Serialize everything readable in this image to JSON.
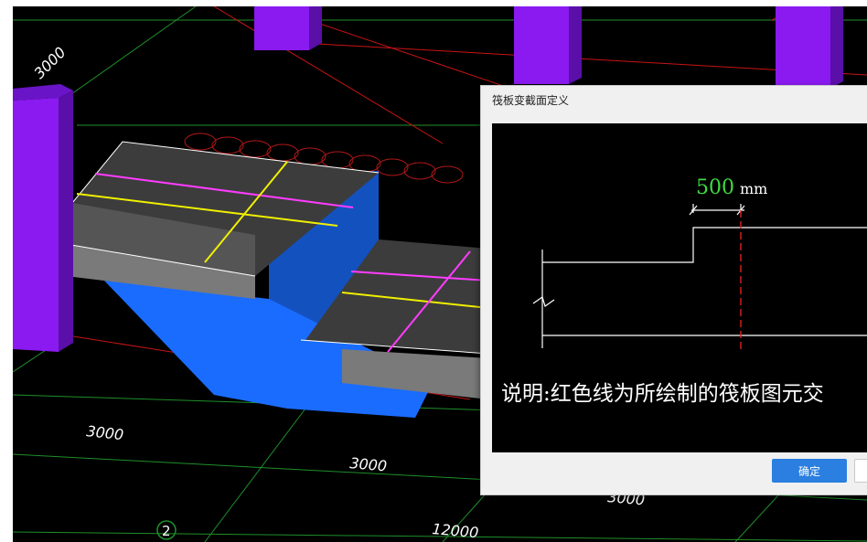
{
  "scene": {
    "dims": {
      "d1": "3000",
      "d2": "3000",
      "d3": "3000",
      "d4": "3000",
      "d5": "12000"
    },
    "axis_label": "2"
  },
  "dialog": {
    "title": "筏板变截面定义",
    "dimension_value": "500",
    "dimension_unit": "mm",
    "note": "说明:红色线为所绘制的筏板图元交",
    "ok_label": "确定",
    "cancel_label": ""
  },
  "colors": {
    "accent": "#2b7fe0",
    "dimension_green": "#3ddc3d",
    "column_purple": "#8a1af0",
    "slab_blue": "#1a6cff"
  }
}
